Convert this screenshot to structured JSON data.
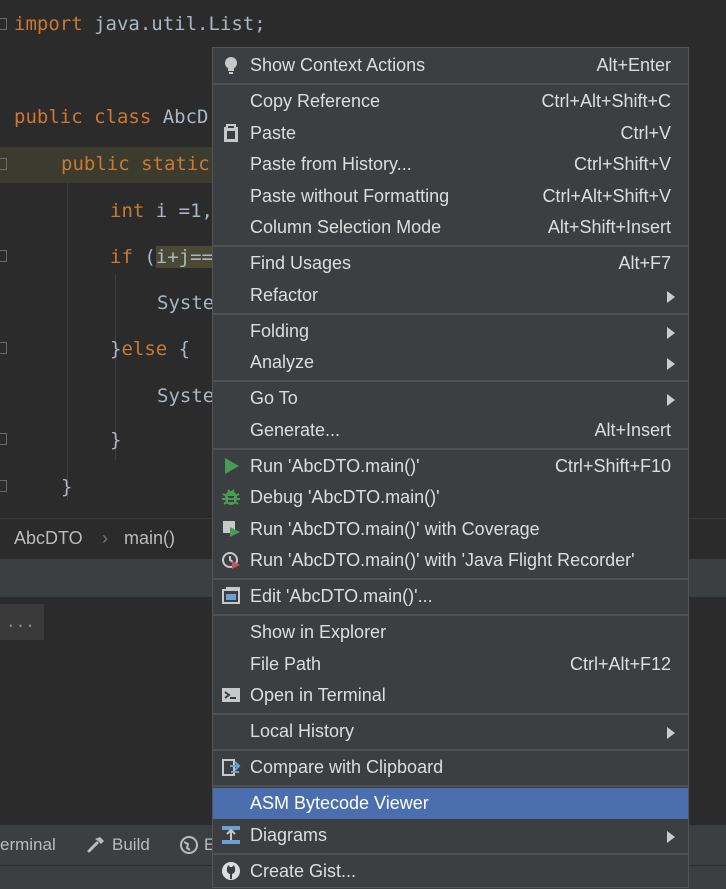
{
  "editor": {
    "line1_kw": "import",
    "line1_rest": " java.util.List;",
    "line2_kw1": "public",
    "line2_kw2": "class",
    "line2_rest": " AbcD",
    "line3_kw1": "public",
    "line3_kw2": "static",
    "line4_kw": "int",
    "line4_rest": " i =1,",
    "line5_kw": "if",
    "line5_paren": " (",
    "line5_hl": "i+j==",
    "line6_text": "Syste",
    "line7_brace": "}",
    "line7_kw": "else",
    "line7_rest": " {",
    "line8_text": "Syste",
    "line9_brace": "}",
    "line10_brace": "}"
  },
  "breadcrumb": {
    "class_name": "AbcDTO",
    "sep": "›",
    "method_name": "main()"
  },
  "tool_area": {
    "dots": "..."
  },
  "bottom_bar": {
    "terminal": "erminal",
    "build": "Build",
    "third": "E"
  },
  "menu": {
    "items": [
      {
        "label": "Show Context Actions",
        "shortcut": "Alt+Enter",
        "icon": "lightbulb-icon"
      },
      {
        "label": "Copy Reference",
        "shortcut": "Ctrl+Alt+Shift+C"
      },
      {
        "label": "Paste",
        "shortcut": "Ctrl+V",
        "icon": "clipboard-icon"
      },
      {
        "label": "Paste from History...",
        "shortcut": "Ctrl+Shift+V"
      },
      {
        "label": "Paste without Formatting",
        "shortcut": "Ctrl+Alt+Shift+V"
      },
      {
        "label": "Column Selection Mode",
        "shortcut": "Alt+Shift+Insert"
      },
      {
        "label": "Find Usages",
        "shortcut": "Alt+F7"
      },
      {
        "label": "Refactor",
        "submenu": true
      },
      {
        "label": "Folding",
        "submenu": true
      },
      {
        "label": "Analyze",
        "submenu": true
      },
      {
        "label": "Go To",
        "submenu": true
      },
      {
        "label": "Generate...",
        "shortcut": "Alt+Insert"
      },
      {
        "label": "Run 'AbcDTO.main()'",
        "shortcut": "Ctrl+Shift+F10",
        "icon": "run-icon"
      },
      {
        "label": "Debug 'AbcDTO.main()'",
        "icon": "debug-bug-icon"
      },
      {
        "label": "Run 'AbcDTO.main()' with Coverage",
        "icon": "coverage-icon"
      },
      {
        "label": "Run 'AbcDTO.main()' with 'Java Flight Recorder'",
        "icon": "flight-recorder-icon"
      },
      {
        "label": "Edit 'AbcDTO.main()'...",
        "icon": "edit-config-icon"
      },
      {
        "label": "Show in Explorer"
      },
      {
        "label": "File Path",
        "shortcut": "Ctrl+Alt+F12"
      },
      {
        "label": "Open in Terminal",
        "icon": "terminal-icon"
      },
      {
        "label": "Local History",
        "submenu": true
      },
      {
        "label": "Compare with Clipboard",
        "icon": "compare-icon"
      },
      {
        "label": "ASM Bytecode Viewer",
        "selected": true
      },
      {
        "label": "Diagrams",
        "submenu": true,
        "icon": "diagram-icon"
      },
      {
        "label": "Create Gist...",
        "icon": "github-icon"
      }
    ]
  },
  "colors": {
    "editor_bg": "#2b2b2b",
    "keyword": "#cc7832",
    "code_text": "#a9b7c6",
    "menu_bg": "#3c3f41",
    "selection": "#4b6eaf",
    "run_green": "#499c54"
  }
}
